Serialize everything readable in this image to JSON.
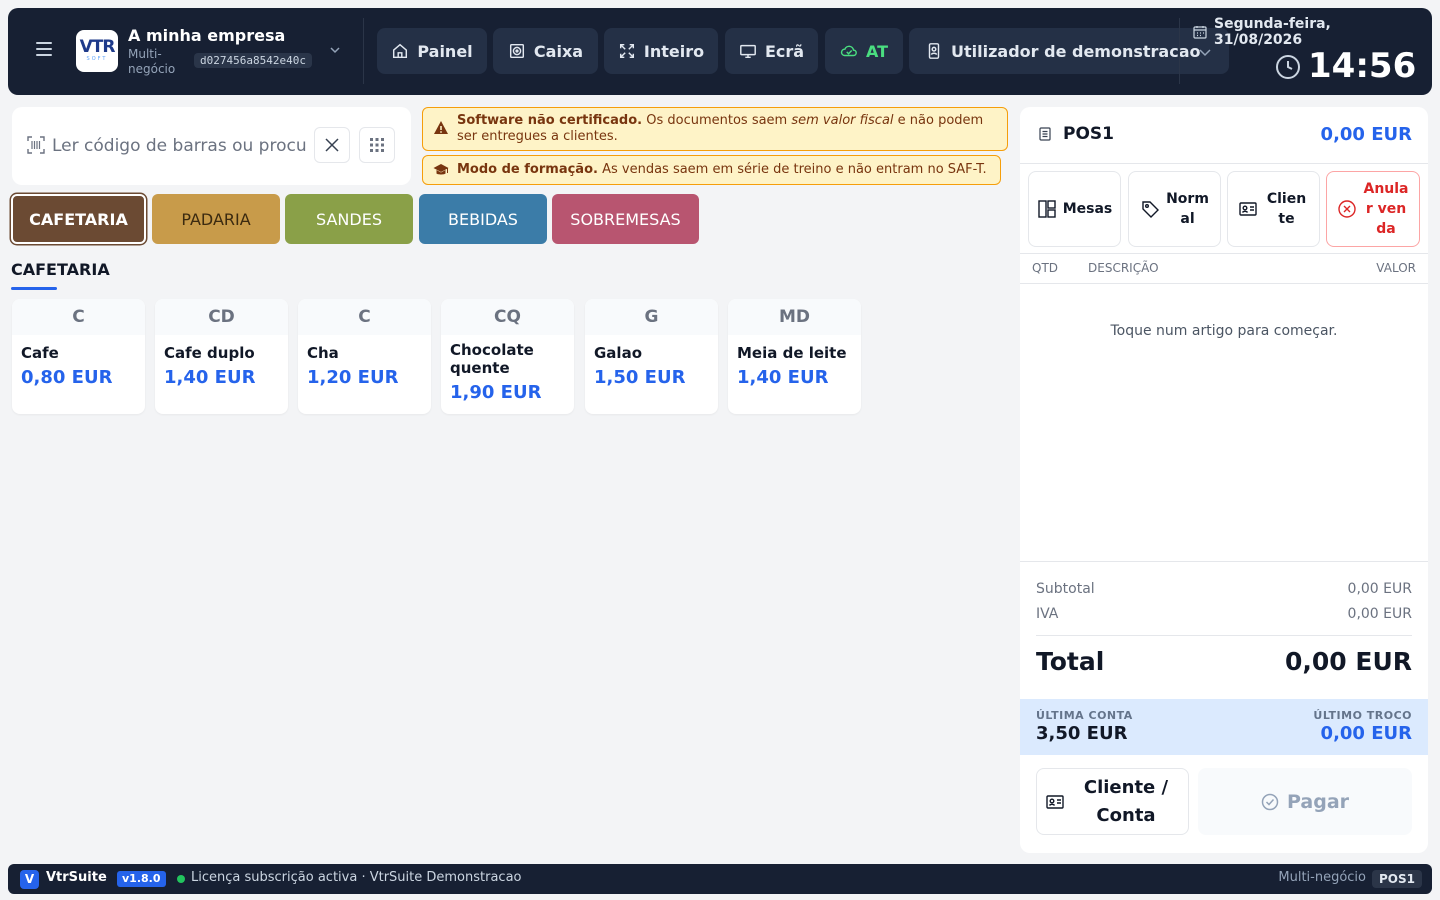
{
  "colors": {
    "topbar": "#172033",
    "accent": "#2563eb",
    "at_green": "#4ade80",
    "warning_bg": "#fef3c7",
    "danger": "#dc2626"
  },
  "header": {
    "logo_text": "VTR",
    "logo_sub": "SOFT",
    "company_name": "A minha empresa",
    "company_subtitle": "Multi-negócio",
    "company_hash": "d027456a8542e40c",
    "nav": [
      {
        "label": "Painel",
        "icon": "home-icon"
      },
      {
        "label": "Caixa",
        "icon": "cash-register-icon"
      },
      {
        "label": "Inteiro",
        "icon": "fullscreen-icon"
      },
      {
        "label": "Ecrã",
        "icon": "monitor-icon"
      },
      {
        "label": "AT",
        "icon": "cloud-check-icon"
      }
    ],
    "user_label": "Utilizador de demonstracao",
    "date_line1": "Segunda-feira,",
    "date_line2": "31/08/2026",
    "time": "14:56"
  },
  "search": {
    "placeholder": "Ler código de barras ou procurar artigo"
  },
  "alerts": {
    "cert_bold": "Software não certificado.",
    "cert_text1": " Os documentos saem ",
    "cert_italic": "sem valor fiscal",
    "cert_text2": " e não podem ser entregues a clientes.",
    "training_bold": "Modo de formação.",
    "training_text": " As vendas saem em série de treino e não entram no SAF-T."
  },
  "categories": [
    "CAFETARIA",
    "PADARIA",
    "SANDES",
    "BEBIDAS",
    "SOBREMESAS"
  ],
  "section_title": "CAFETARIA",
  "products": [
    {
      "abbr": "C",
      "name": "Cafe",
      "price": "0,80 EUR"
    },
    {
      "abbr": "CD",
      "name": "Cafe duplo",
      "price": "1,40 EUR"
    },
    {
      "abbr": "C",
      "name": "Cha",
      "price": "1,20 EUR"
    },
    {
      "abbr": "CQ",
      "name": "Chocolate quente",
      "price": "1,90 EUR"
    },
    {
      "abbr": "G",
      "name": "Galao",
      "price": "1,50 EUR"
    },
    {
      "abbr": "MD",
      "name": "Meia de leite",
      "price": "1,40 EUR"
    }
  ],
  "ticket": {
    "pos_name": "POS1",
    "pos_total": "0,00 EUR",
    "actions": [
      "Mesas",
      "Normal",
      "Cliente",
      "Anular venda"
    ],
    "col_qty": "QTD",
    "col_desc": "DESCRIÇÃO",
    "col_value": "VALOR",
    "empty_message": "Toque num artigo para começar.",
    "subtotal_label": "Subtotal",
    "subtotal_value": "0,00 EUR",
    "iva_label": "IVA",
    "iva_value": "0,00 EUR",
    "total_label": "Total",
    "total_value": "0,00 EUR",
    "last_bill_label": "ÚLTIMA CONTA",
    "last_bill_value": "3,50 EUR",
    "last_change_label": "ÚLTIMO TROCO",
    "last_change_value": "0,00 EUR",
    "client_button": "Cliente / Conta",
    "pay_button": "Pagar"
  },
  "footer": {
    "logo_letter": "V",
    "app_name": "VtrSuite",
    "version": "v1.8.0",
    "license": "Licença subscrição activa · VtrSuite Demonstracao",
    "business": "Multi-negócio",
    "pos": "POS1"
  }
}
